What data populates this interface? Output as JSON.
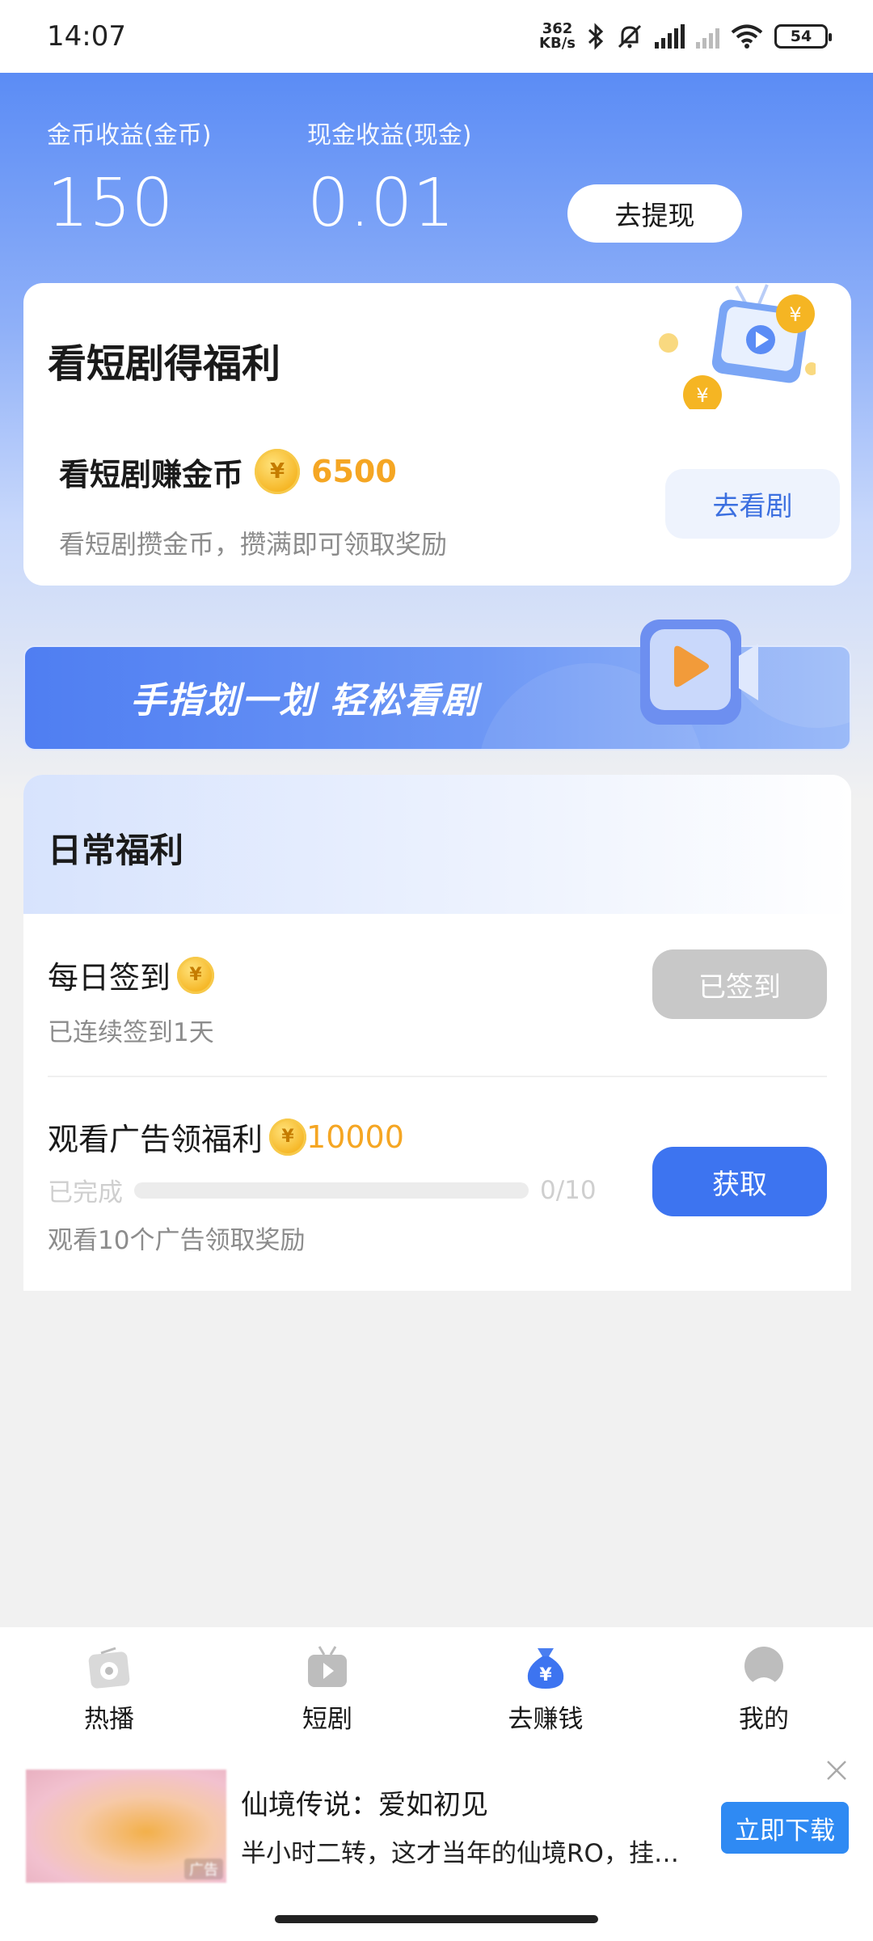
{
  "status_bar": {
    "time": "14:07",
    "net_speed_top": "362",
    "net_speed_bottom": "KB/s",
    "battery": "54"
  },
  "earnings": {
    "coin_label": "金币收益(金币)",
    "coin_value": "150",
    "cash_label": "现金收益(现金)",
    "cash_value": "0.01",
    "withdraw_label": "去提现"
  },
  "drama_card": {
    "title": "看短剧得福利",
    "task_label": "看短剧赚金币",
    "task_reward": "6500",
    "task_desc": "看短剧攒金币，攒满即可领取奖励",
    "watch_button": "去看剧"
  },
  "banner": {
    "text": "手指划一划 轻松看剧"
  },
  "daily": {
    "title": "日常福利",
    "checkin": {
      "name": "每日签到",
      "sub": "已连续签到1天",
      "button": "已签到"
    },
    "ads": {
      "name": "观看广告领福利",
      "reward": "10000",
      "progress_label": "已完成",
      "progress_text": "0/10",
      "progress_fraction": 0,
      "desc": "观看10个广告领取奖励",
      "button": "获取"
    }
  },
  "nav": {
    "tabs": [
      {
        "label": "热播",
        "icon": "radio-icon"
      },
      {
        "label": "短剧",
        "icon": "tv-icon"
      },
      {
        "label": "去赚钱",
        "icon": "money-bag-icon",
        "active": true
      },
      {
        "label": "我的",
        "icon": "profile-icon"
      }
    ]
  },
  "ad": {
    "tag": "广告",
    "title": "仙境传说：爱如初见",
    "desc": "半小时二转，这才当年的仙境RO，挂…",
    "download": "立即下载"
  },
  "colors": {
    "accent": "#3d74f0",
    "coin": "#f5a623",
    "download": "#2f8af3"
  }
}
